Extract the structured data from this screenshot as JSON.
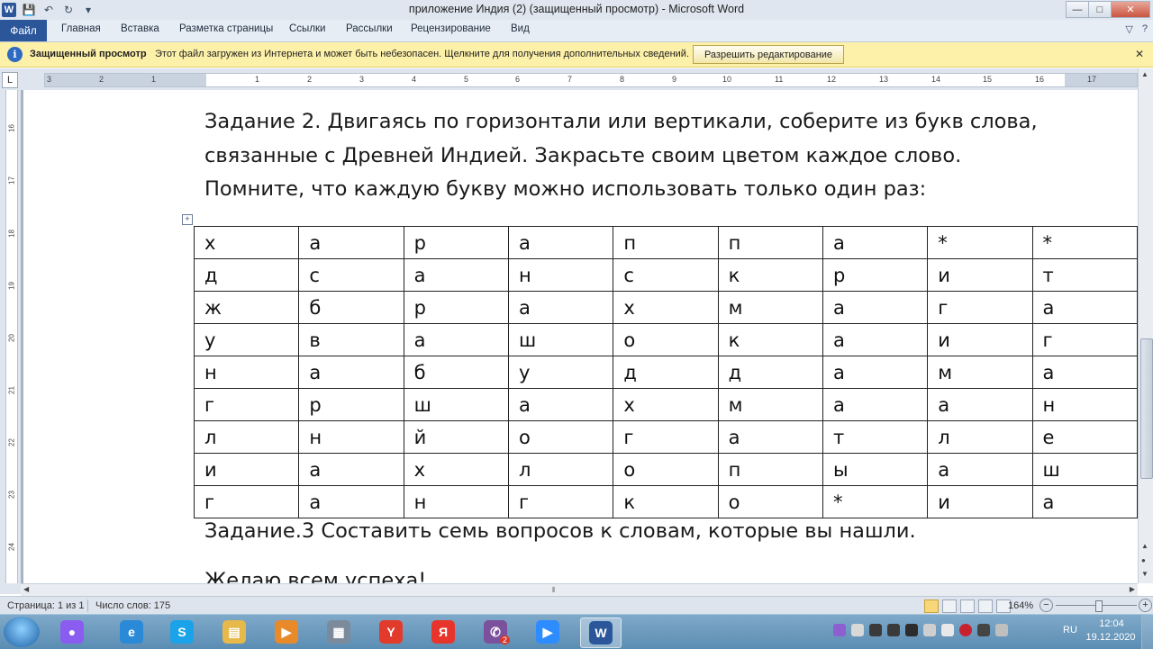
{
  "window": {
    "title": "приложение  Индия (2) (защищенный просмотр)  -  Microsoft Word",
    "controls": {
      "minimize": "—",
      "maximize": "□",
      "close": "✕"
    }
  },
  "quick_access": {
    "app_logo": "W",
    "save": "💾",
    "undo": "↶",
    "redo": "↻",
    "customize": "▾"
  },
  "ribbon": {
    "file_tab": "Файл",
    "tabs": [
      "Главная",
      "Вставка",
      "Разметка страницы",
      "Ссылки",
      "Рассылки",
      "Рецензирование",
      "Вид"
    ],
    "right_icons": [
      "▽",
      "?"
    ]
  },
  "protected_view": {
    "icon": "i",
    "title": "Защищенный просмотр",
    "message": "Этот файл загружен из Интернета и может быть небезопасен. Щелкните для получения дополнительных сведений.",
    "button": "Разрешить редактирование",
    "close": "✕"
  },
  "ruler": {
    "corner": "L",
    "numbers": [
      "3",
      "2",
      "1",
      "1",
      "2",
      "3",
      "4",
      "5",
      "6",
      "7",
      "8",
      "9",
      "10",
      "11",
      "12",
      "13",
      "14",
      "15",
      "16",
      "17"
    ],
    "vertical_numbers": [
      "16",
      "17",
      "18",
      "19",
      "20",
      "21",
      "22",
      "23",
      "24"
    ]
  },
  "document": {
    "task2_lines": [
      "Задание 2. Двигаясь по горизонтали или вертикали, соберите из букв слова,",
      "связанные с Древней Индией. Закрасьте своим цветом каждое слово.",
      "Помните, что каждую букву можно использовать только один раз:"
    ],
    "table_handle": "+",
    "grid": [
      [
        "х",
        "а",
        "р",
        "а",
        "п",
        "п",
        "а",
        "*",
        "*"
      ],
      [
        "д",
        "с",
        "а",
        "н",
        "с",
        "к",
        "р",
        "и",
        "т"
      ],
      [
        "ж",
        "б",
        "р",
        "а",
        "х",
        "м",
        "а",
        "г",
        "а"
      ],
      [
        "у",
        "в",
        "а",
        "ш",
        "о",
        "к",
        "а",
        "и",
        "г"
      ],
      [
        "н",
        "а",
        "б",
        "у",
        "д",
        "д",
        "а",
        "м",
        "а"
      ],
      [
        "г",
        "р",
        "ш",
        "а",
        "х",
        "м",
        "а",
        "а",
        "н"
      ],
      [
        "л",
        "н",
        "й",
        "о",
        "г",
        "а",
        "т",
        "л",
        "е"
      ],
      [
        "и",
        "а",
        "х",
        "л",
        "о",
        "п",
        "ы",
        "а",
        "ш"
      ],
      [
        "г",
        "а",
        "н",
        "г",
        "к",
        "о",
        "*",
        "и",
        "а"
      ]
    ],
    "task3": "Задание.3  Составить  семь  вопросов к словам, которые вы нашли.",
    "closing": "Желаю всем успеха!"
  },
  "status_bar": {
    "page": "Страница: 1 из 1",
    "words": "Число слов: 175",
    "zoom": "164%",
    "zoom_minus": "−",
    "zoom_plus": "+"
  },
  "taskbar": {
    "apps": [
      {
        "name": "alisa",
        "glyph": "●",
        "color": "#8a5cf0"
      },
      {
        "name": "ie",
        "glyph": "e",
        "color": "#2a8ad8"
      },
      {
        "name": "skype",
        "glyph": "S",
        "color": "#1aa3e8"
      },
      {
        "name": "explorer",
        "glyph": "▤",
        "color": "#e6b94a"
      },
      {
        "name": "media",
        "glyph": "▶",
        "color": "#e88a2a"
      },
      {
        "name": "calculator",
        "glyph": "▦",
        "color": "#7c8b9c"
      },
      {
        "name": "yandex-browser",
        "glyph": "Y",
        "color": "#e23b2b"
      },
      {
        "name": "yandex",
        "glyph": "Я",
        "color": "#e8352b"
      },
      {
        "name": "viber",
        "glyph": "✆",
        "color": "#7b519d"
      },
      {
        "name": "zoom",
        "glyph": "▶",
        "color": "#2d8cff"
      },
      {
        "name": "word",
        "glyph": "W",
        "color": "#2b579a"
      }
    ],
    "viber_badge": "2",
    "lang": "RU",
    "time": "12:04",
    "date": "19.12.2020"
  }
}
